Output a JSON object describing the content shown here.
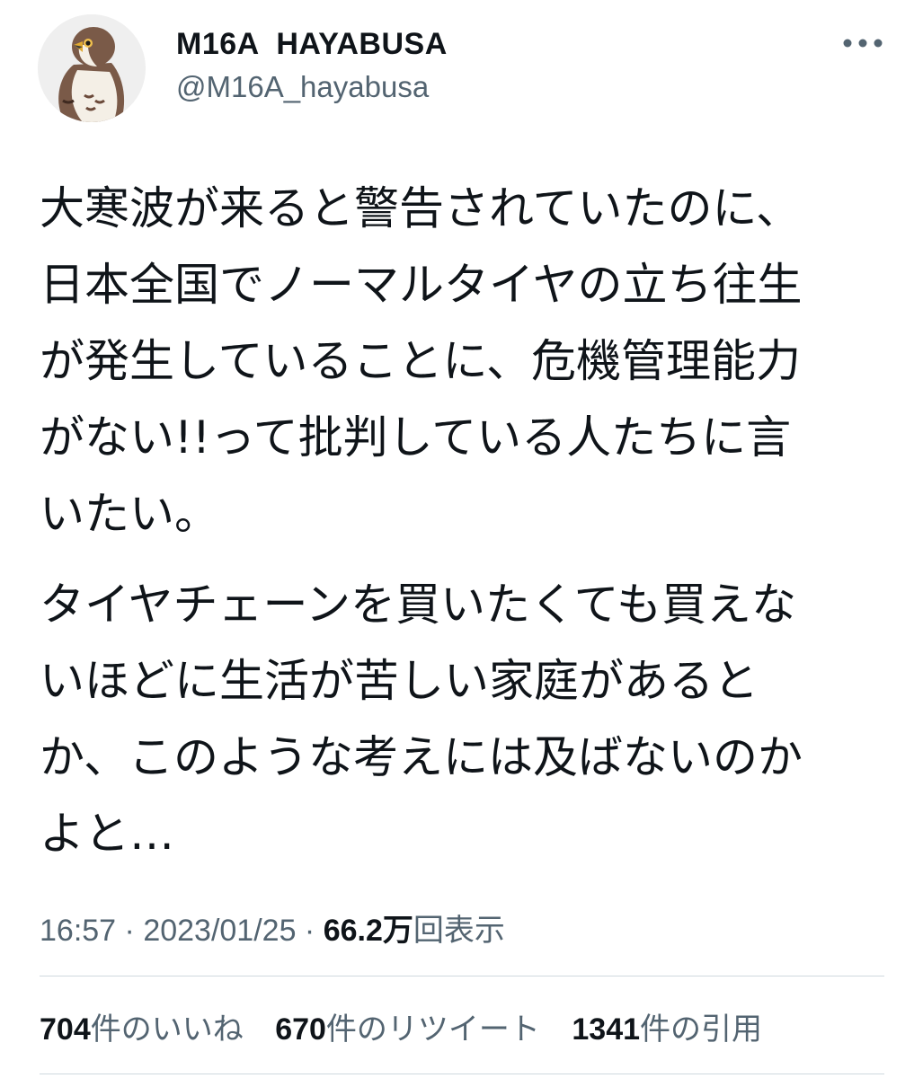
{
  "author": {
    "display_name": "M16A  HAYABUSA",
    "handle": "@M16A_hayabusa",
    "avatar_icon": "falcon-avatar-icon"
  },
  "more_icon": "more-dots-icon",
  "tweet": {
    "paragraph_1": "大寒波が来ると警告されていたのに、\n日本全国でノーマルタイヤの立ち往生\nが発生していることに、危機管理能力\nがない!!って批判している人たちに言\nいたい。",
    "paragraph_2": "タイヤチェーンを買いたくても買えな\nいほどに生活が苦しい家庭があると\nか、このような考えには及ばないのか\nよと…"
  },
  "meta": {
    "time": "16:57",
    "separator_1": " · ",
    "date": "2023/01/25",
    "separator_2": " · ",
    "views_count": "66.2万",
    "views_label": "回表示"
  },
  "stats": {
    "likes_count": "704",
    "likes_label": "件のいいね",
    "retweets_count": "670",
    "retweets_label": "件のリツイート",
    "quotes_count": "1341",
    "quotes_label": "件の引用"
  },
  "colors": {
    "text_primary": "#0f1419",
    "text_secondary": "#536471",
    "divider": "#cfd9de"
  }
}
